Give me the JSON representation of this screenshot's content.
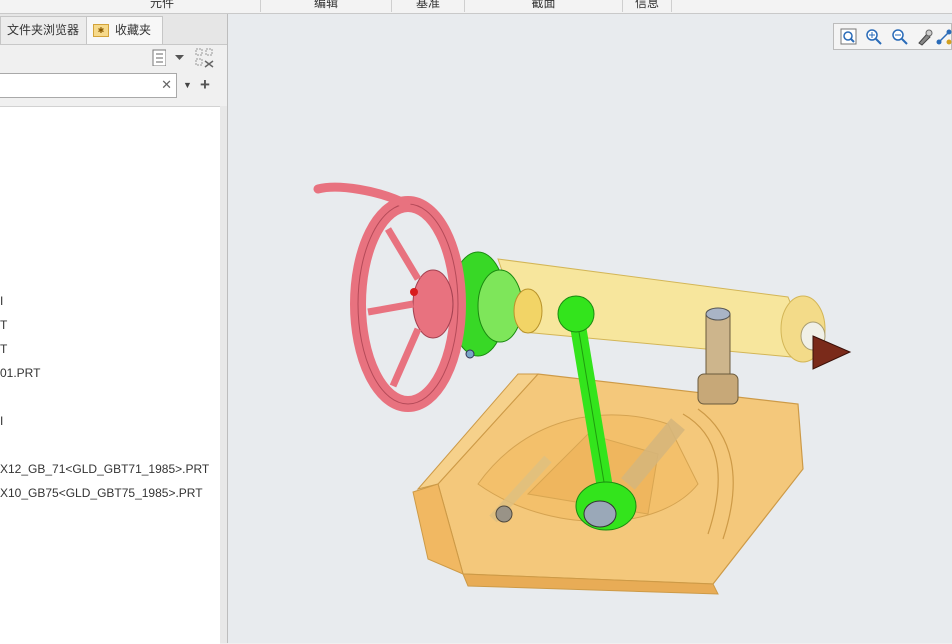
{
  "ribbon": {
    "groups": [
      "元件",
      "编辑",
      "基准",
      "截面",
      "信息"
    ]
  },
  "left_panel": {
    "tabs": [
      {
        "label": "文件夹浏览器",
        "icon": "folder-browser-icon"
      },
      {
        "label": "收藏夹",
        "icon": "favorites-icon"
      }
    ],
    "search": {
      "value": "",
      "clear": "✕",
      "dropdown": "▼",
      "add": "+"
    },
    "tree_items": [
      "I",
      "T",
      "T",
      "01.PRT",
      "I",
      "X12_GB_71<GLD_GBT71_1985>.PRT",
      "X10_GB75<GLD_GBT75_1985>.PRT"
    ]
  },
  "view_toolbar": {
    "icons": [
      "zoom-window-icon",
      "zoom-in-icon",
      "zoom-out-icon",
      "repaint-icon",
      "orient-icon"
    ]
  },
  "colors": {
    "viewport_bg": "#e8ebee",
    "handwheel": "#e8727f",
    "lever": "#33e41c",
    "body_fill": "#f6b33a"
  }
}
